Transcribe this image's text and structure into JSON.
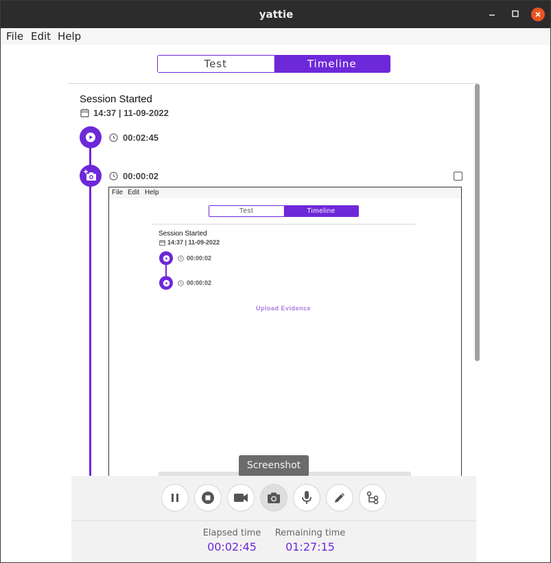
{
  "window": {
    "title": "yattie"
  },
  "menu": {
    "items": [
      "File",
      "Edit",
      "Help"
    ]
  },
  "tabs": {
    "test": "Test",
    "timeline": "Timeline",
    "active": "Timeline"
  },
  "session": {
    "title": "Session Started",
    "datetime": "14:37 | 11-09-2022"
  },
  "timeline": [
    {
      "type": "video",
      "time": "00:02:45"
    },
    {
      "type": "screenshot",
      "time": "00:00:02",
      "checked": false
    }
  ],
  "preview": {
    "menu": [
      "File",
      "Edit",
      "Help"
    ],
    "tabs": {
      "test": "Test",
      "timeline": "Timeline"
    },
    "session_title": "Session Started",
    "session_datetime": "14:37 | 11-09-2022",
    "entries": [
      {
        "time": "00:00:02"
      },
      {
        "time": "00:00:02"
      }
    ],
    "upload_label": "Upload Evidence"
  },
  "tooltip": "Screenshot",
  "toolbar": {
    "buttons": [
      "pause-icon",
      "stop-icon",
      "video-camera-icon",
      "camera-icon",
      "microphone-icon",
      "pencil-icon",
      "mindmap-icon"
    ],
    "elapsed_label": "Elapsed time",
    "elapsed_value": "00:02:45",
    "remaining_label": "Remaining time",
    "remaining_value": "01:27:15"
  },
  "colors": {
    "accent": "#6d28d9",
    "close_button": "#e95420",
    "titlebar": "#2c2c2c"
  }
}
